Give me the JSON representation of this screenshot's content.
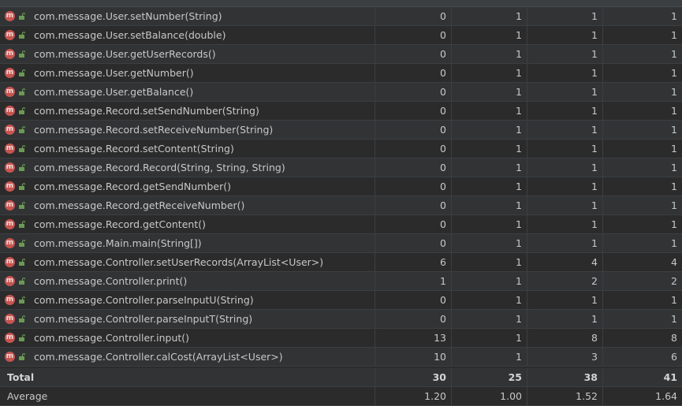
{
  "methods": [
    {
      "name": "com.message.User.setNumber(String)",
      "v": [
        "0",
        "1",
        "1",
        "1"
      ]
    },
    {
      "name": "com.message.User.setBalance(double)",
      "v": [
        "0",
        "1",
        "1",
        "1"
      ]
    },
    {
      "name": "com.message.User.getUserRecords()",
      "v": [
        "0",
        "1",
        "1",
        "1"
      ]
    },
    {
      "name": "com.message.User.getNumber()",
      "v": [
        "0",
        "1",
        "1",
        "1"
      ]
    },
    {
      "name": "com.message.User.getBalance()",
      "v": [
        "0",
        "1",
        "1",
        "1"
      ]
    },
    {
      "name": "com.message.Record.setSendNumber(String)",
      "v": [
        "0",
        "1",
        "1",
        "1"
      ]
    },
    {
      "name": "com.message.Record.setReceiveNumber(String)",
      "v": [
        "0",
        "1",
        "1",
        "1"
      ]
    },
    {
      "name": "com.message.Record.setContent(String)",
      "v": [
        "0",
        "1",
        "1",
        "1"
      ]
    },
    {
      "name": "com.message.Record.Record(String, String, String)",
      "v": [
        "0",
        "1",
        "1",
        "1"
      ]
    },
    {
      "name": "com.message.Record.getSendNumber()",
      "v": [
        "0",
        "1",
        "1",
        "1"
      ]
    },
    {
      "name": "com.message.Record.getReceiveNumber()",
      "v": [
        "0",
        "1",
        "1",
        "1"
      ]
    },
    {
      "name": "com.message.Record.getContent()",
      "v": [
        "0",
        "1",
        "1",
        "1"
      ]
    },
    {
      "name": "com.message.Main.main(String[])",
      "v": [
        "0",
        "1",
        "1",
        "1"
      ]
    },
    {
      "name": "com.message.Controller.setUserRecords(ArrayList<User>)",
      "v": [
        "6",
        "1",
        "4",
        "4"
      ]
    },
    {
      "name": "com.message.Controller.print()",
      "v": [
        "1",
        "1",
        "2",
        "2"
      ]
    },
    {
      "name": "com.message.Controller.parseInputU(String)",
      "v": [
        "0",
        "1",
        "1",
        "1"
      ]
    },
    {
      "name": "com.message.Controller.parseInputT(String)",
      "v": [
        "0",
        "1",
        "1",
        "1"
      ]
    },
    {
      "name": "com.message.Controller.input()",
      "v": [
        "13",
        "1",
        "8",
        "8"
      ]
    },
    {
      "name": "com.message.Controller.calCost(ArrayList<User>)",
      "v": [
        "10",
        "1",
        "3",
        "6"
      ]
    }
  ],
  "icon": {
    "method_badge_letter": "m",
    "method_badge_color": "#c75450",
    "lock_color": "#6a9955"
  },
  "total": {
    "label": "Total",
    "v": [
      "30",
      "25",
      "38",
      "41"
    ]
  },
  "average": {
    "label": "Average",
    "v": [
      "1.20",
      "1.00",
      "1.52",
      "1.64"
    ]
  }
}
